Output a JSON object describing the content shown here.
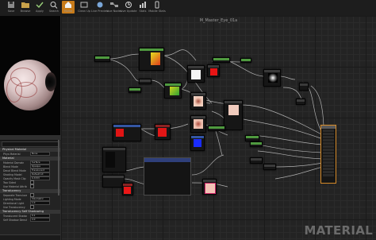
{
  "toolbar": {
    "buttons": [
      {
        "label": "Save",
        "icon": "save-icon"
      },
      {
        "label": "Browse",
        "icon": "folder-icon"
      },
      {
        "label": "Apply",
        "icon": "apply-icon"
      },
      {
        "label": "Search",
        "icon": "search-icon"
      },
      {
        "label": "Home",
        "icon": "home-icon"
      },
      {
        "label": "Clean Up",
        "icon": "clean-icon"
      },
      {
        "label": "Live Preview",
        "icon": "preview-icon"
      },
      {
        "label": "Live Nodes",
        "icon": "nodes-icon"
      },
      {
        "label": "Live Update",
        "icon": "update-icon"
      },
      {
        "label": "Stats",
        "icon": "stats-icon"
      },
      {
        "label": "Mobile Stats",
        "icon": "mobile-icon"
      }
    ]
  },
  "graph": {
    "title": "M_Master_Eye_01a",
    "watermark": "MATERIAL"
  },
  "details": {
    "sections": [
      {
        "title": "Physical Material",
        "props": [
          {
            "key": "Phys Material",
            "value": "None"
          }
        ]
      },
      {
        "title": "Material",
        "props": [
          {
            "key": "Material Domain",
            "value": "Surface"
          },
          {
            "key": "Blend Mode",
            "value": "Opaque"
          },
          {
            "key": "Decal Blend Mode",
            "value": "Translucent"
          },
          {
            "key": "Shading Model",
            "value": "Default Lit"
          },
          {
            "key": "Opacity Mask Clip",
            "value": "0.3333"
          },
          {
            "key": "Two Sided",
            "value": ""
          },
          {
            "key": "Use Material Attributes",
            "value": ""
          }
        ]
      },
      {
        "title": "Translucency",
        "props": [
          {
            "key": "Separate Translucency",
            "value": ""
          },
          {
            "key": "Lighting Mode",
            "value": "Volumetric"
          },
          {
            "key": "Directional Light",
            "value": "1.0"
          },
          {
            "key": "Use Translucency",
            "value": ""
          }
        ]
      },
      {
        "title": "Translucency Self Shadowing",
        "props": [
          {
            "key": "Translucent Shadow",
            "value": "0.1"
          },
          {
            "key": "Self Shadow Density",
            "value": "2.0"
          },
          {
            "key": "Self Shadow Second",
            "value": "10.0"
          },
          {
            "key": "Backscatter Exponent",
            "value": "30.0"
          }
        ]
      },
      {
        "title": "Usage",
        "props": []
      }
    ]
  },
  "colors": {
    "accent": "#c77b1a",
    "node_green": "#4f9a3f",
    "node_red": "#8b2323",
    "node_blue": "#3456a3",
    "main_node_border": "#d58a28"
  }
}
